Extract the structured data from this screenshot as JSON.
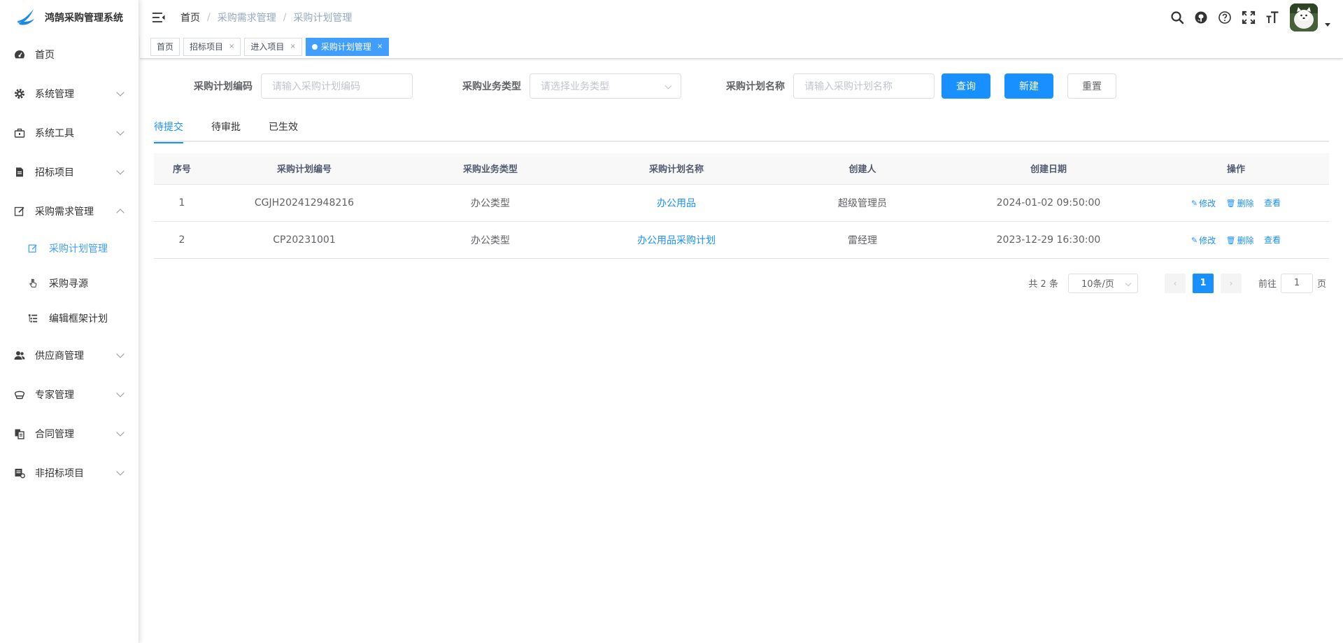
{
  "app": {
    "title": "鸿鹄采购管理系统"
  },
  "sidebar": {
    "items": [
      {
        "label": "首页",
        "icon": "dashboard-icon"
      },
      {
        "label": "系统管理",
        "icon": "gear-icon"
      },
      {
        "label": "系统工具",
        "icon": "toolbox-icon"
      },
      {
        "label": "招标项目",
        "icon": "document-icon"
      },
      {
        "label": "采购需求管理",
        "icon": "edit-icon",
        "expanded": true
      },
      {
        "label": "供应商管理",
        "icon": "people-icon"
      },
      {
        "label": "专家管理",
        "icon": "expert-icon"
      },
      {
        "label": "合同管理",
        "icon": "contract-icon"
      },
      {
        "label": "非招标项目",
        "icon": "project-icon"
      }
    ],
    "submenu": [
      {
        "label": "采购计划管理",
        "icon": "edit-icon",
        "active": true
      },
      {
        "label": "采购寻源",
        "icon": "hand-pointer-icon"
      },
      {
        "label": "编辑框架计划",
        "icon": "tree-list-icon"
      }
    ]
  },
  "breadcrumb": [
    "首页",
    "采购需求管理",
    "采购计划管理"
  ],
  "tags": [
    {
      "label": "首页",
      "closable": false
    },
    {
      "label": "招标项目",
      "closable": true
    },
    {
      "label": "进入项目",
      "closable": true
    },
    {
      "label": "采购计划管理",
      "closable": true,
      "active": true
    }
  ],
  "tag_close_glyph": "×",
  "search": {
    "plan_code_label": "采购计划编码",
    "plan_code_placeholder": "请输入采购计划编码",
    "biz_type_label": "采购业务类型",
    "biz_type_placeholder": "请选择业务类型",
    "plan_name_label": "采购计划名称",
    "plan_name_placeholder": "请输入采购计划名称",
    "query_button": "查询",
    "new_button": "新建",
    "reset_button": "重置"
  },
  "tabs": [
    {
      "label": "待提交",
      "active": true
    },
    {
      "label": "待审批"
    },
    {
      "label": "已生效"
    }
  ],
  "table": {
    "columns": [
      "序号",
      "采购计划编号",
      "采购业务类型",
      "采购计划名称",
      "创建人",
      "创建日期",
      "操作"
    ],
    "rows": [
      {
        "index": "1",
        "code": "CGJH202412948216",
        "type": "办公类型",
        "name": "办公用品",
        "creator": "超级管理员",
        "date": "2024-01-02 09:50:00"
      },
      {
        "index": "2",
        "code": "CP20231001",
        "type": "办公类型",
        "name": "办公用品采购计划",
        "creator": "雷经理",
        "date": "2023-12-29 16:30:00"
      }
    ],
    "actions": {
      "edit": "修改",
      "delete": "删除",
      "view": "查看"
    }
  },
  "pagination": {
    "total_text": "共 2 条",
    "page_size": "10条/页",
    "current_page": "1",
    "goto_prefix": "前往",
    "goto_value": "1",
    "goto_suffix": "页"
  },
  "colors": {
    "primary": "#1890ff",
    "active_tag": "#409eff"
  }
}
